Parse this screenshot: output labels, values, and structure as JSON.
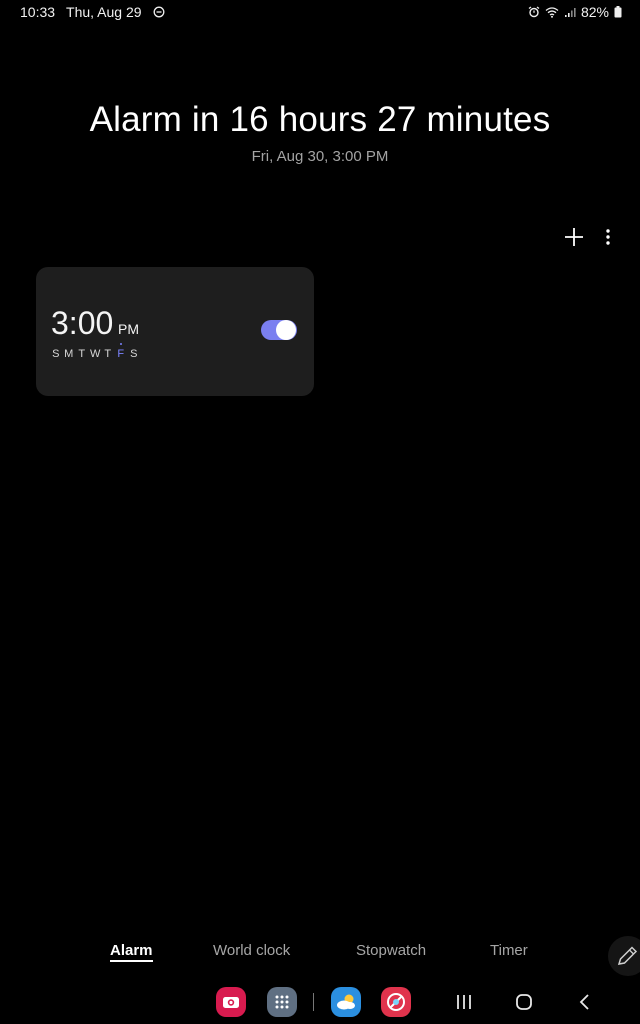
{
  "status_bar": {
    "time": "10:33",
    "date": "Thu, Aug 29",
    "battery": "82%"
  },
  "header": {
    "title": "Alarm in 16 hours 27 minutes",
    "subtitle": "Fri, Aug 30, 3:00 PM"
  },
  "toolbar": {
    "add_icon": "plus-icon",
    "more_icon": "more-vertical-icon"
  },
  "alarm": {
    "time": "3:00",
    "ampm": "PM",
    "enabled": true,
    "days": [
      "S",
      "M",
      "T",
      "W",
      "T",
      "F",
      "S"
    ],
    "active_day_index": 5,
    "accent": "#7a7ff0"
  },
  "tabs": [
    {
      "label": "Alarm"
    },
    {
      "label": "World clock"
    },
    {
      "label": "Stopwatch"
    },
    {
      "label": "Timer"
    }
  ],
  "dock": {
    "apps": [
      {
        "name": "camera-app-icon",
        "color": "#d81b4f"
      },
      {
        "name": "apps-drawer-icon",
        "color": "#5f6f82"
      },
      {
        "name": "weather-app-icon",
        "color": "#2b8fe0"
      },
      {
        "name": "browser-app-icon",
        "color": "#e0334c"
      }
    ],
    "nav": [
      "recent-apps-icon",
      "home-icon",
      "back-icon"
    ]
  }
}
